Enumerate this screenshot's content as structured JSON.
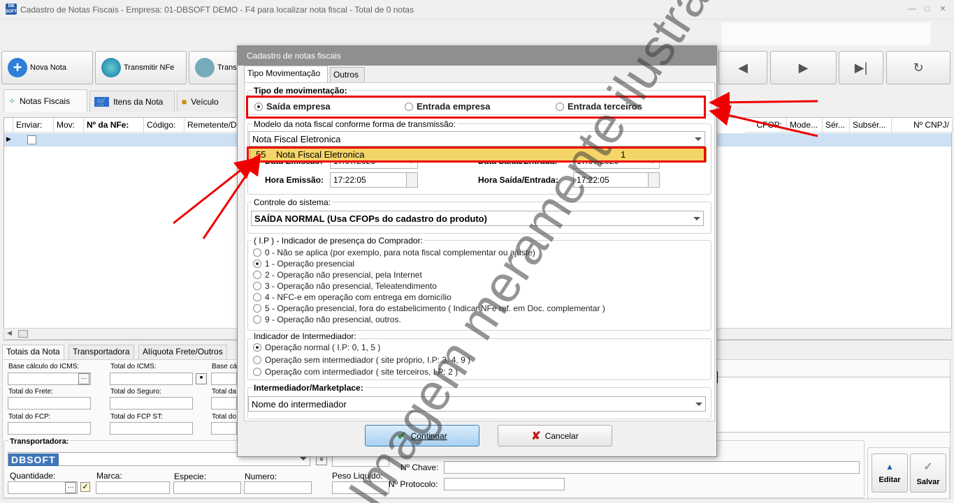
{
  "window": {
    "icon_label": "DB SOFT",
    "title": "Cadastro de Notas Fiscais - Empresa: 01-DBSOFT DEMO - F4 para localizar nota fiscal - Total de 0 notas"
  },
  "toolbar": {
    "nova_nota": "Nova Nota",
    "transmitir_nfe": "Transmitir NFe",
    "trans": "Trans"
  },
  "tabs": {
    "notas_fiscais": "Notas Fiscais",
    "itens_da_nota": "Itens da Nota",
    "veiculo": "Veículo"
  },
  "grid": {
    "columns_left": [
      "Enviar:",
      "Mov:",
      "Nº da NFe:",
      "Código:",
      "Remetente/D"
    ],
    "columns_right": [
      "CFOP:",
      "Mode...",
      "Sér...",
      "Subsér...",
      "Nº CNPJ/"
    ]
  },
  "bottom_tabs": {
    "totais": "Totais da Nota",
    "transportadora": "Transportadora",
    "aliquota": "Alíquota Frete/Outros"
  },
  "totals": {
    "base_icms": "Base cálculo do ICMS:",
    "total_icms": "Total do ICMS:",
    "base_cut": "Base cál",
    "total_frete": "Total do Frete:",
    "total_seguro": "Total do Seguro:",
    "total_da": "Total da",
    "total_fcp": "Total do FCP:",
    "total_fcp_st": "Total do FCP ST:",
    "total_do": "Total do"
  },
  "transport": {
    "label": "Transportadora:",
    "quantidade": "Quantidade:",
    "marca": "Marca:",
    "especie": "Especie:",
    "numero": "Numero:",
    "peso_liquido": "Peso Liquido:",
    "chave": "Nº Chave:",
    "protocolo": "Nº Protocolo:",
    "brand": "DBSOFT"
  },
  "actions": {
    "editar": "Editar",
    "salvar": "Salvar"
  },
  "dialog": {
    "title": "Cadastro de notas fiscais",
    "tab_movimentacao": "Tipo Movimentação",
    "tab_outros": "Outros",
    "tipo_label": "Tipo de movimentação:",
    "saida_empresa": "Saída empresa",
    "entrada_empresa": "Entrada empresa",
    "entrada_terceiros": "Entrada terceiros",
    "modelo_label": "Modelo da nota fiscal conforme forma de transmissão:",
    "modelo_value": "Nota Fiscal Eletronica",
    "dropdown_code": "55",
    "dropdown_item": "Nota Fiscal Eletronica",
    "dropdown_num": "1",
    "data_emissao_label": "Data Emissão:",
    "data_emissao": "17/07/2026",
    "data_saida_label": "Data Saída/Entrada:",
    "data_saida": "17/07/2026",
    "hora_emissao_label": "Hora Emissão:",
    "hora_emissao": "17:22:05",
    "hora_saida_label": "Hora Saída/Entrada:",
    "hora_saida": "17:22:05",
    "controle_label": "Controle do sistema:",
    "controle_value": "SAÍDA NORMAL (Usa CFOPs do cadastro do produto)",
    "presenca_label": "( I.P ) - Indicador de presença do Comprador:",
    "presenca_options": [
      "0 - Não se aplica (por exemplo, para nota fiscal complementar ou ajuste)",
      "1 - Operação presencial",
      "2 - Operação não presencial, pela Internet",
      "3 - Operação não presencial, Teleatendimento",
      "4 - NFC-e em operação com entrega em domicílio",
      "5 - Operação presencial, fora do estabelicimento ( Indicar NFe ref. em Doc. complementar )",
      "9 - Operação não presencial, outros."
    ],
    "intermediador_label": "Indicador de Intermediador:",
    "intermediador_options": [
      "Operação normal ( I.P: 0, 1, 5 )",
      "Operação sem intermediador ( site próprio, I.P: 3, 4, 9 )",
      "Operação com intermediador ( site terceiros, I.P: 2 )"
    ],
    "marketplace_label": "Intermediador/Marketplace:",
    "marketplace_value": "Nome do intermediador",
    "continuar": "Continuar",
    "cancelar": "Cancelar"
  },
  "watermark": "Imagem meramente ilustrativa",
  "colors": {
    "highlight_red": "#e00000",
    "selected_row": "#cde0f4",
    "dropdown_highlight": "#f6d568"
  }
}
